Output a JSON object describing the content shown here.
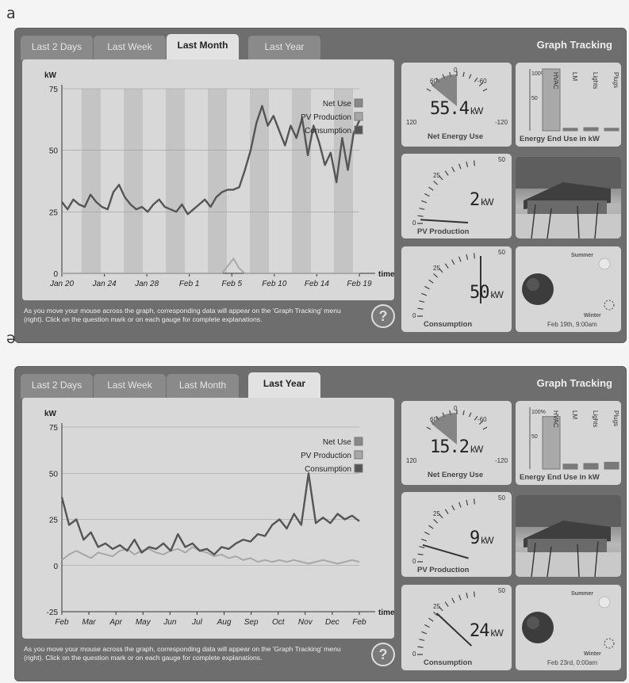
{
  "panels": [
    {
      "label": "a",
      "tabs": [
        "Last 2 Days",
        "Last Week",
        "Last Month",
        "Last Year"
      ],
      "active_tab": 2,
      "graph_tracking": "Graph Tracking",
      "chart_data": {
        "type": "line",
        "ylabel": "kW",
        "xlabel": "time",
        "ylim": [
          0,
          75
        ],
        "yticks": [
          "0",
          "25",
          "50",
          "75"
        ],
        "x_tick_labels": [
          "Jan 20",
          "Jan 24",
          "Jan 28",
          "Feb 1",
          "Feb 5",
          "Feb 10",
          "Feb 14",
          "Feb 19"
        ],
        "legend": [
          "Net Use",
          "PV Production",
          "Consumption"
        ],
        "consumption": [
          29,
          26,
          30,
          28,
          27,
          32,
          29,
          27,
          26,
          33,
          36,
          31,
          28,
          26,
          27,
          25,
          28,
          30,
          27,
          26,
          25,
          28,
          24,
          26,
          28,
          30,
          27,
          31,
          33,
          34,
          34,
          35,
          42,
          50,
          61,
          68,
          60,
          64,
          58,
          52,
          60,
          55,
          63,
          48,
          60,
          53,
          44,
          49,
          37,
          55,
          42,
          57,
          62
        ],
        "pv": [
          0,
          0,
          0,
          0,
          0,
          0,
          0,
          0,
          0,
          0,
          0,
          0,
          0,
          0,
          0,
          0,
          0,
          0,
          0,
          0,
          0,
          0,
          0,
          0,
          0,
          0,
          0,
          0,
          0,
          3,
          6,
          2,
          0,
          0,
          0,
          0,
          0,
          0,
          0,
          0,
          0,
          0,
          0,
          0,
          0,
          0,
          0,
          0,
          0,
          0,
          0,
          0,
          0
        ]
      },
      "help_text": "As you move your mouse across the graph, corresponding data will appear on the 'Graph Tracking' menu (right). Click on the question mark or on each gauge for complete explanations.",
      "help_icon": "?",
      "net_energy": {
        "label": "Net Energy Use",
        "value": "55.4",
        "unit": "kW",
        "ticks": [
          "60",
          "0",
          "-60",
          "120",
          "-120"
        ]
      },
      "end_use": {
        "label": "Energy End Use in kW",
        "bars": [
          "HVAC",
          "LM",
          "Lights",
          "Plugs"
        ],
        "levels": [
          1.0,
          0.04,
          0.05,
          0.04
        ],
        "scale": [
          "100%",
          "50"
        ]
      },
      "pv_production": {
        "label": "PV Production",
        "value": "2",
        "unit": "kW",
        "ticks": [
          "25",
          "50",
          "0"
        ]
      },
      "consumption_gauge": {
        "label": "Consumption",
        "value": "50",
        "unit": "kW",
        "ticks": [
          "25",
          "50",
          "0"
        ]
      },
      "season": {
        "summer": "Summer",
        "winter": "Winter",
        "date": "Feb 19th, 9:00am"
      }
    },
    {
      "label": "ə",
      "tabs": [
        "Last 2 Days",
        "Last Week",
        "Last Month",
        "Last Year"
      ],
      "active_tab": 3,
      "graph_tracking": "Graph Tracking",
      "chart_data": {
        "type": "line",
        "ylabel": "kW",
        "xlabel": "time",
        "ylim": [
          -25,
          75
        ],
        "yticks": [
          "-25",
          "0",
          "25",
          "50",
          "75"
        ],
        "x_tick_labels": [
          "Feb",
          "Mar",
          "Apr",
          "May",
          "Jun",
          "Jul",
          "Aug",
          "Sep",
          "Oct",
          "Nov",
          "Dec",
          "Feb"
        ],
        "legend": [
          "Net Use",
          "PV Production",
          "Consumption"
        ],
        "consumption": [
          37,
          22,
          25,
          14,
          18,
          10,
          12,
          9,
          11,
          8,
          14,
          7,
          10,
          9,
          12,
          8,
          17,
          10,
          12,
          8,
          9,
          6,
          10,
          9,
          12,
          14,
          13,
          17,
          16,
          22,
          25,
          20,
          28,
          22,
          50,
          23,
          26,
          23,
          28,
          25,
          27,
          24
        ],
        "pv": [
          3,
          6,
          8,
          6,
          4,
          7,
          6,
          5,
          8,
          9,
          6,
          8,
          9,
          7,
          6,
          8,
          9,
          7,
          10,
          8,
          7,
          5,
          6,
          4,
          5,
          3,
          4,
          2,
          3,
          2,
          3,
          2,
          3,
          2,
          1,
          2,
          3,
          2,
          1,
          2,
          3,
          2
        ]
      },
      "help_text": "As you move your mouse across the graph, corresponding data will appear on the 'Graph Tracking' menu (right). Click on the question mark or on each gauge for complete explanations.",
      "help_icon": "?",
      "net_energy": {
        "label": "Net Energy Use",
        "value": "15.2",
        "unit": "kW",
        "ticks": [
          "60",
          "0",
          "-60",
          "120",
          "-120"
        ]
      },
      "end_use": {
        "label": "Energy End Use in kW",
        "bars": [
          "HVAC",
          "LM",
          "Lights",
          "Plugs"
        ],
        "levels": [
          0.85,
          0.08,
          0.09,
          0.11
        ],
        "scale": [
          "100%",
          "50"
        ]
      },
      "pv_production": {
        "label": "PV Production",
        "value": "9",
        "unit": "kW",
        "ticks": [
          "25",
          "50",
          "0"
        ]
      },
      "consumption_gauge": {
        "label": "Consumption",
        "value": "24",
        "unit": "kW",
        "ticks": [
          "25",
          "50",
          "0"
        ]
      },
      "season": {
        "summer": "Summer",
        "winter": "Winter",
        "date": "Feb 23rd, 0:00am"
      }
    }
  ],
  "colors": {
    "consumption": "#555555",
    "pv": "#a8a8a8",
    "net": "#888888",
    "frame": "#6e6e6e",
    "band": "#bfbfbf"
  }
}
